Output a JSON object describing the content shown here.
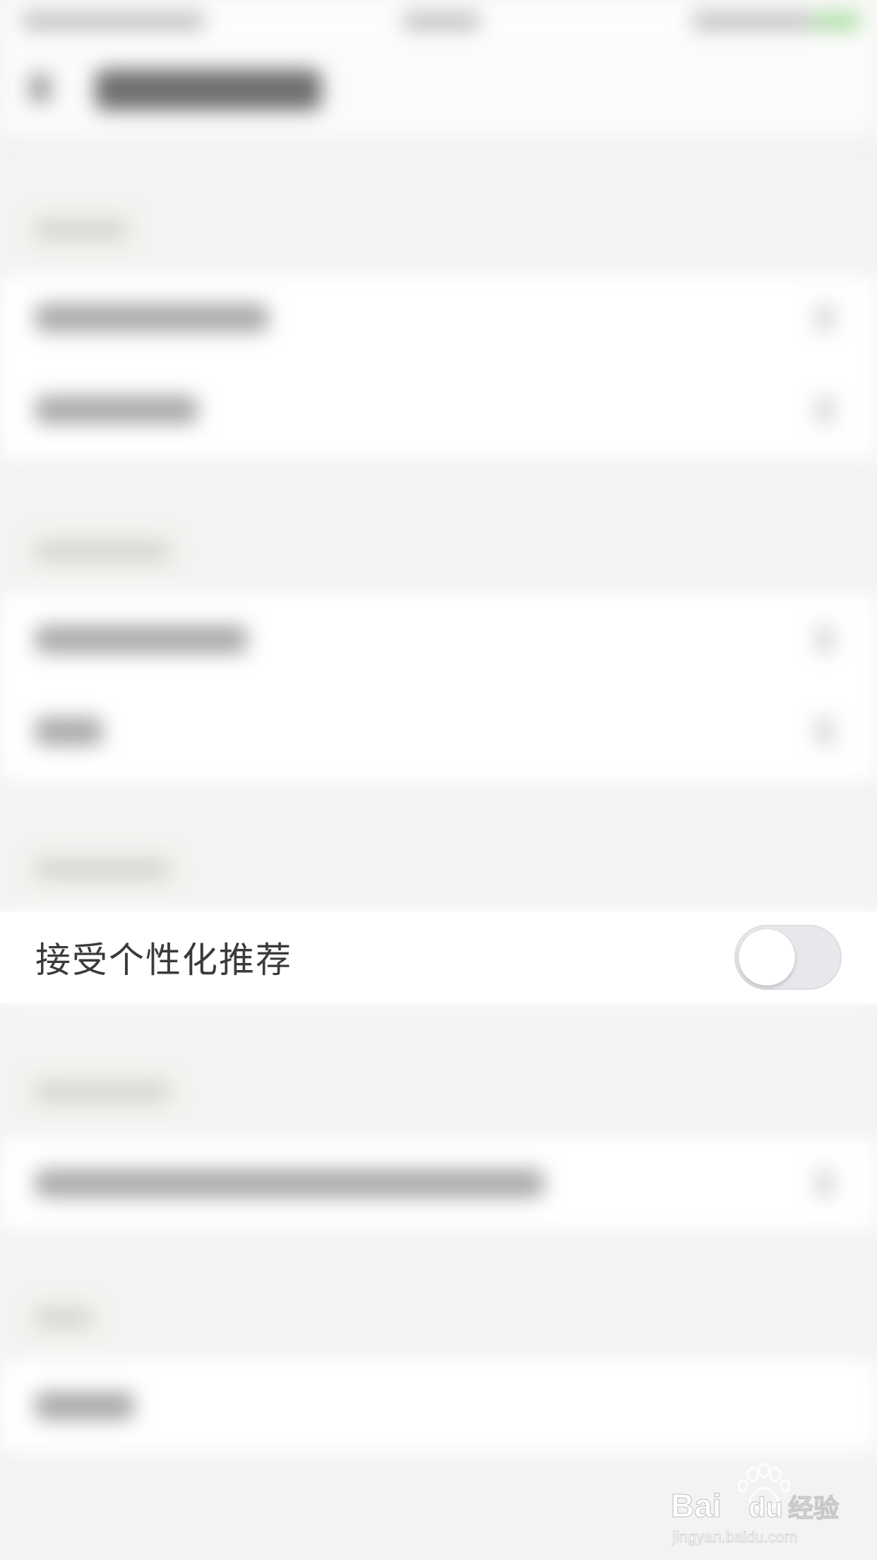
{
  "setting": {
    "label": "接受个性化推荐",
    "enabled": false
  },
  "watermark": {
    "brand": "Baidu经验",
    "url": "jingyan.baidu.com"
  }
}
